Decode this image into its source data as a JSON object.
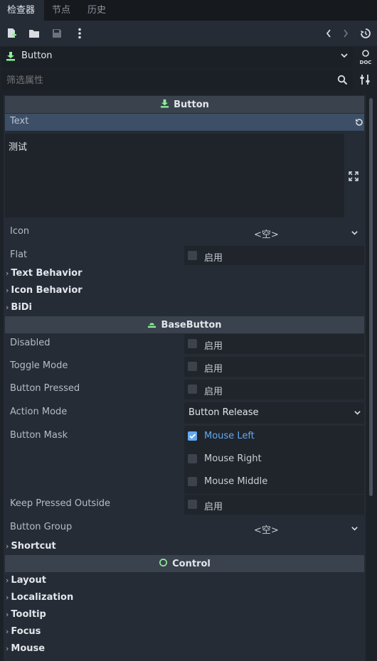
{
  "tabs": [
    "检查器",
    "节点",
    "历史"
  ],
  "toolbar": {
    "icons": [
      "new-resource-icon",
      "open-folder-icon",
      "save-icon",
      "more-icon",
      "back-icon",
      "forward-icon",
      "history-icon"
    ]
  },
  "object_selector": {
    "value": "Button",
    "doc_label": "DOC"
  },
  "filter": {
    "placeholder": "筛选属性"
  },
  "sections": {
    "button": "Button",
    "base_button": "BaseButton",
    "control": "Control"
  },
  "props": {
    "text_label": "Text",
    "text_value": "测试",
    "icon_label": "Icon",
    "icon_value": "<空>",
    "flat_label": "Flat",
    "enable_label": "启用",
    "disabled_label": "Disabled",
    "toggle_label": "Toggle Mode",
    "pressed_label": "Button Pressed",
    "action_label": "Action Mode",
    "action_value": "Button Release",
    "mask_label": "Button Mask",
    "mask_options": [
      "Mouse Left",
      "Mouse Right",
      "Mouse Middle"
    ],
    "keep_label": "Keep Pressed Outside",
    "group_label": "Button Group",
    "group_value": "<空>"
  },
  "categories": {
    "text_behavior": "Text Behavior",
    "icon_behavior": "Icon Behavior",
    "bidi": "BiDi",
    "shortcut": "Shortcut",
    "layout": "Layout",
    "localization": "Localization",
    "tooltip": "Tooltip",
    "focus": "Focus",
    "mouse": "Mouse"
  },
  "colors": {
    "accent": "#63a9f0",
    "node_green": "#8eef97",
    "section_bg": "#3a424d"
  }
}
